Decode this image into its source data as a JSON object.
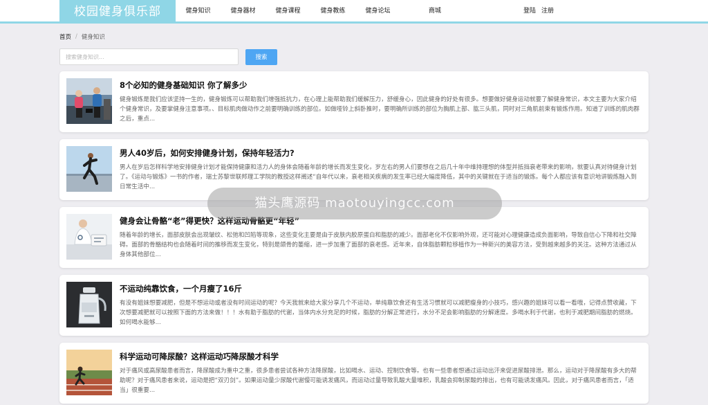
{
  "header": {
    "logo": "校园健身俱乐部",
    "nav": [
      "健身知识",
      "健身器材",
      "健身课程",
      "健身教练",
      "健身论坛",
      "商城"
    ],
    "login": "登陆",
    "register": "注册",
    "accent_color": "#8fd6e6"
  },
  "breadcrumb": {
    "home": "首页",
    "separator": "/",
    "current": "健身知识"
  },
  "search": {
    "placeholder": "搜索健身知识...",
    "button": "搜索",
    "button_color": "#4ea6f3"
  },
  "articles": [
    {
      "title": "8个必知的健身基础知识 你了解多少",
      "desc": "健身锻炼是我们应该坚持一生的，健身锻炼可以帮助我们增强抵抗力，在心理上能帮助我们缓解压力，舒缓身心，因此健身的好处有很多。想要做好健身运动就要了解健身常识，本文主要为大家介绍个健身常识，及要掌健身注意事项。、目标肌肉做动作之前要明确训练的部位。如做哑铃上斜卧推时，要明确所训练的部位为胸肌上部、肱三头肌，同时对三角肌前束有锻炼作用。知道了训练的肌肉群之后，重点...",
      "image": "gym-photo"
    },
    {
      "title": "男人40岁后，如何安排健身计划，保持年轻活力?",
      "desc": "男人在岁后怎样科学地安排健身计划才能保持健康和活力人的身体会随着年龄的增长而发生变化，岁左右的男人们要想在之后几十年中维持理想的体型并抵挡衰老带来的影响，就要认真对待健身计划了。《运动与锻炼》一书的作者，瑞士苏黎世联邦理工学院的教授这样阐述“自年代以来，衰老相关疾病的发生率已经大幅度降低，其中的关键就在于适当的锻炼。每个人都应该有意识地讲锻炼融入到日常生活中...",
      "image": "running-man-photo"
    },
    {
      "title": "健身会让骨骼“老”得更快？这样运动骨骼更“年轻”",
      "desc": "随着年龄的增长，面部皮肤会出现皱纹、松弛和凹陷等现象，这些变化主要是由于皮肤内胶原蛋白和脂肪的减少。面部老化不仅影响外观，还可能对心理健康造成负面影响，导致自信心下降和社交障碍。面部的骨骼结构也会随着时间的推移而发生变化，特别是颌骨的萎缩，进一步加重了面部的衰老感。近年来，自体脂肪颗粒移植作为一种新兴的美容方法，受到越来越多的关注。这种方法通过从身体其他部位...",
      "image": "doctor-photo"
    },
    {
      "title": "不运动纯靠饮食，一个月瘦了16斤",
      "desc": "有没有姐妹想要减肥，但是不想运动或者没有时间运动的呢？今天我就来给大家分享几个不运动，单纯靠饮食还有生活习惯就可以减肥瘦身的小技巧，感兴趣的姐妹可以看一看哦，记得点赞收藏，下次想要减肥就可以按照下面的方法来做！！！水有助于脂肪的代谢，当体内水分充足的时候，脂肪的分解正常进行，水分不足会影响脂肪的分解速度。多喝水利于代谢，也利于减肥期间脂肪的燃烧。如何喝水能够...",
      "image": "water-bottle-photo"
    },
    {
      "title": "科学运动可降尿酸？这样运动巧降尿酸才科学",
      "desc": "对于痛风或高尿酸患者而言，降尿酸成为重中之重，很多患者尝试各种方法降尿酸，比如喝水、运动、控制饮食等。也有一些患者想通过运动出汗来促进尿酸排泄。那么，运动对于降尿酸有多大的帮助呢？对于痛风患者来说，运动是把“双刃剑”。如果运动量少尿酸代谢慢可能诱发痛风，而运动过量导致乳酸大量堆积，乳酸会抑制尿酸的排出，也有可能诱发痛风。因此，对于痛风患者而言，「适当」很重要...",
      "image": "track-runner-photo"
    }
  ],
  "watermark": "猫头鹰源码 maotouyingcc.com"
}
